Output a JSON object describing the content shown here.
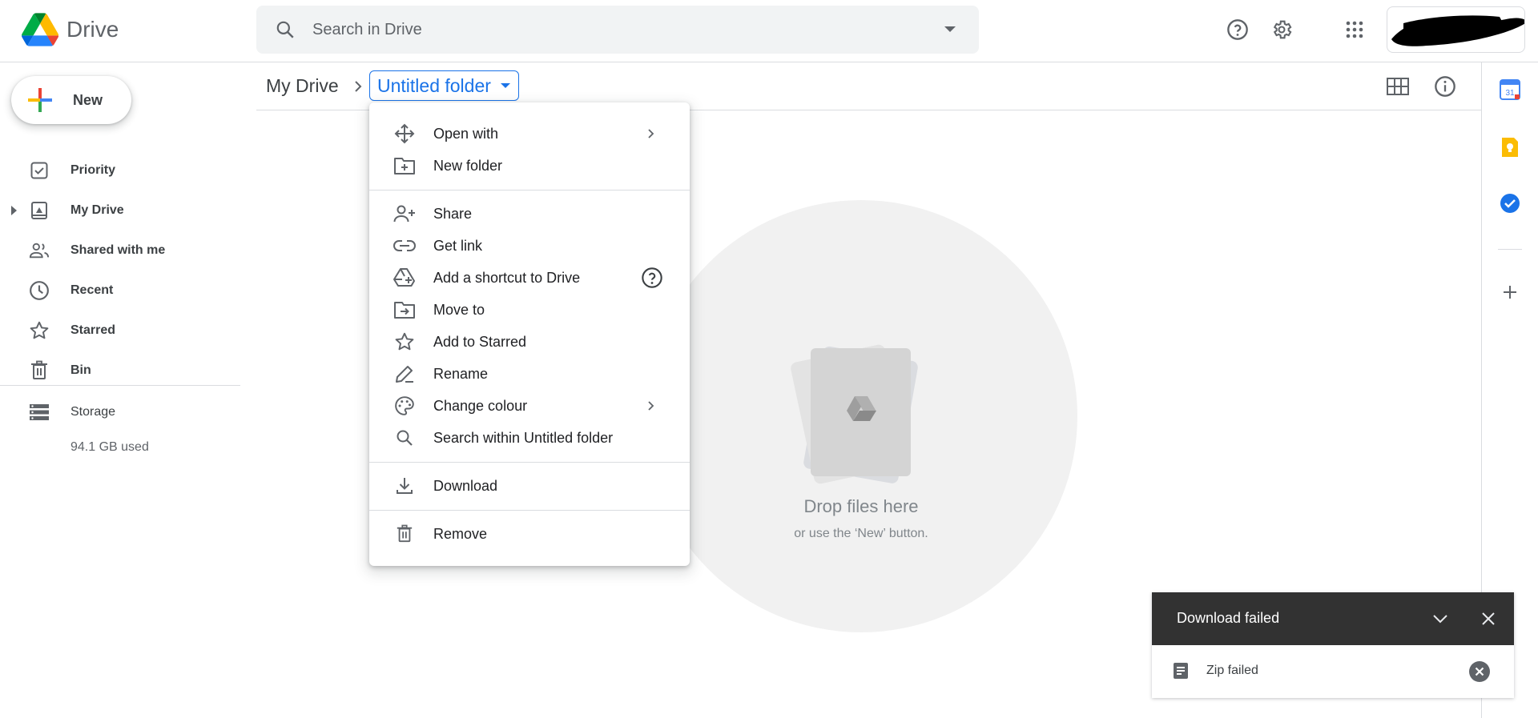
{
  "header": {
    "app_name": "Drive",
    "search_placeholder": "Search in Drive",
    "icons": [
      "drive-logo-icon",
      "search-icon",
      "search-options-icon",
      "help-icon",
      "settings-icon",
      "apps-grid-icon"
    ]
  },
  "sidebar": {
    "new_label": "New",
    "items": [
      {
        "label": "Priority",
        "icon": "priority-icon"
      },
      {
        "label": "My Drive",
        "icon": "my-drive-icon"
      },
      {
        "label": "Shared with me",
        "icon": "shared-icon"
      },
      {
        "label": "Recent",
        "icon": "clock-icon"
      },
      {
        "label": "Starred",
        "icon": "star-icon"
      },
      {
        "label": "Bin",
        "icon": "trash-icon"
      }
    ],
    "storage_label": "Storage",
    "storage_used": "94.1 GB used"
  },
  "breadcrumb": {
    "root": "My Drive",
    "current": "Untitled folder"
  },
  "empty_state": {
    "title": "Drop files here",
    "subtitle": "or use the ‘New’ button."
  },
  "context_menu": {
    "items": [
      {
        "label": "Open with",
        "icon": "open-with-icon",
        "submenu": true
      },
      {
        "label": "New folder",
        "icon": "new-folder-icon"
      },
      {
        "label": "Share",
        "icon": "share-person-icon"
      },
      {
        "label": "Get link",
        "icon": "link-icon"
      },
      {
        "label": "Add a shortcut to Drive",
        "icon": "shortcut-icon",
        "help": true
      },
      {
        "label": "Move to",
        "icon": "move-to-icon"
      },
      {
        "label": "Add to Starred",
        "icon": "star-outline-icon"
      },
      {
        "label": "Rename",
        "icon": "pencil-icon"
      },
      {
        "label": "Change colour",
        "icon": "palette-icon",
        "submenu": true
      },
      {
        "label": "Search within Untitled folder",
        "icon": "search-icon"
      },
      {
        "label": "Download",
        "icon": "download-icon"
      },
      {
        "label": "Remove",
        "icon": "trash-icon"
      }
    ]
  },
  "snackbar": {
    "title": "Download failed",
    "item_text": "Zip failed"
  },
  "colors": {
    "accent": "#1a73e8",
    "snackbar_bg": "#323232",
    "divider": "#dadce0"
  }
}
